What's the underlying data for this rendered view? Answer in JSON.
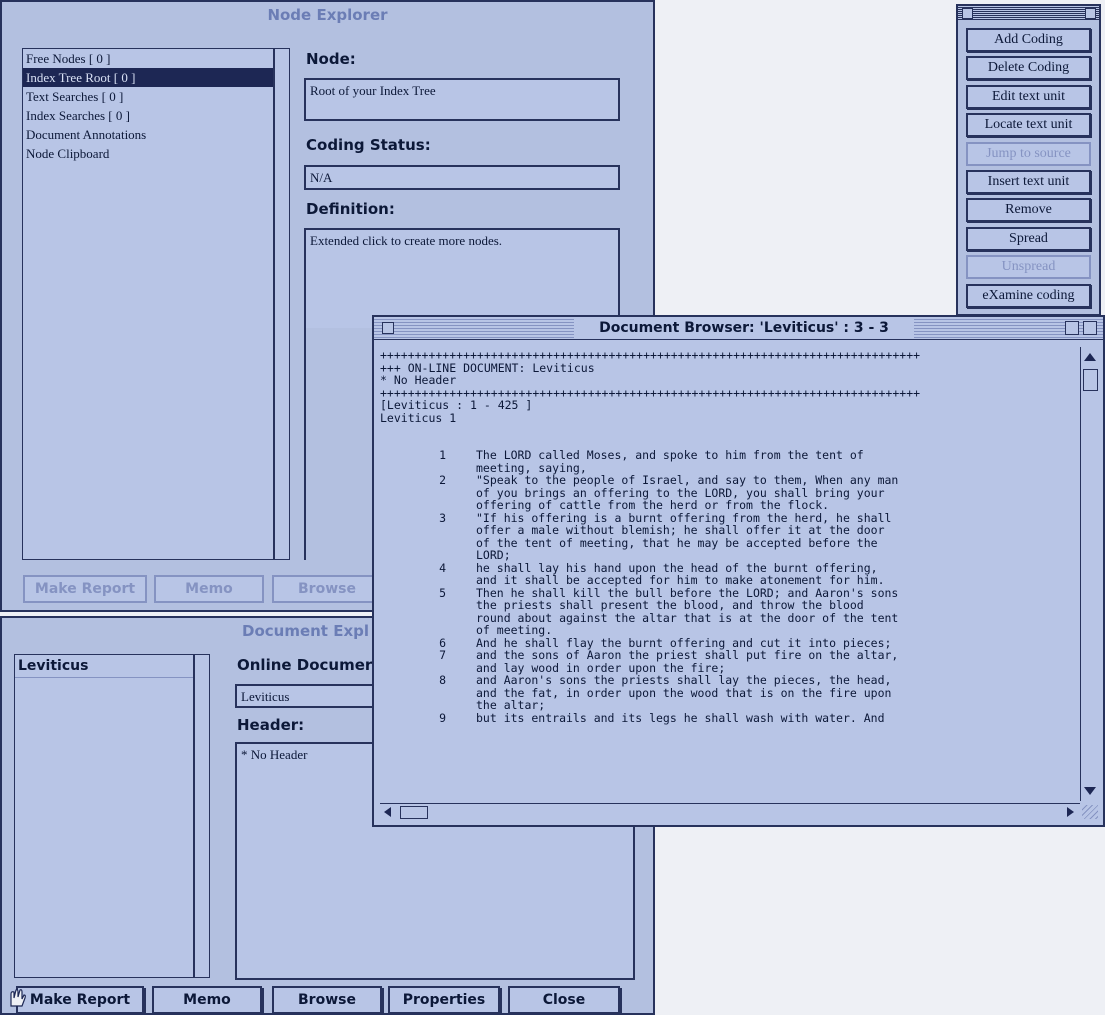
{
  "node_explorer": {
    "title": "Node Explorer",
    "tree_items": [
      "Free Nodes [ 0 ]",
      "Index Tree Root [ 0 ]",
      "Text Searches [ 0 ]",
      "Index Searches [ 0 ]",
      "Document Annotations",
      "Node Clipboard"
    ],
    "selected_index": 1,
    "node_label": "Node:",
    "node_value": "Root of your Index Tree",
    "coding_status_label": "Coding Status:",
    "coding_status_value": "N/A",
    "definition_label": "Definition:",
    "definition_value": "Extended click to create more nodes.",
    "buttons": {
      "make_report": "Make Report",
      "memo": "Memo",
      "browse": "Browse"
    }
  },
  "document_explorer": {
    "title": "Document Expl",
    "doc_items": [
      "Leviticus"
    ],
    "online_doc_label": "Online Documer",
    "online_doc_value": "Leviticus",
    "header_label": "Header:",
    "header_value": "* No Header",
    "buttons": {
      "make_report": "Make Report",
      "memo": "Memo",
      "browse": "Browse",
      "properties": "Properties",
      "close": "Close"
    }
  },
  "coding_palette": {
    "buttons": [
      {
        "label": "Add Coding",
        "enabled": true
      },
      {
        "label": "Delete Coding",
        "enabled": true
      },
      {
        "label": "Edit text unit",
        "enabled": true
      },
      {
        "label": "Locate text unit",
        "enabled": true
      },
      {
        "label": "Jump to source",
        "enabled": false
      },
      {
        "label": "Insert text unit",
        "enabled": true
      },
      {
        "label": "Remove",
        "enabled": true
      },
      {
        "label": "Spread",
        "enabled": true
      },
      {
        "label": "Unspread",
        "enabled": false
      },
      {
        "label": "eXamine coding",
        "enabled": true
      }
    ]
  },
  "document_browser": {
    "title": "Document Browser: 'Leviticus' : 3 - 3",
    "rule": "++++++++++++++++++++++++++++++++++++++++++++++++++++++++++++++++++++++++++++++",
    "head": [
      "+++ ON-LINE DOCUMENT: Leviticus",
      "* No Header"
    ],
    "range": "[Leviticus : 1 - 425 ]",
    "chapter": "Leviticus 1",
    "verses": [
      {
        "n": "1",
        "lines": [
          "The LORD called Moses, and spoke to him from the tent of",
          "meeting, saying,"
        ]
      },
      {
        "n": "2",
        "lines": [
          "\"Speak to the people of Israel, and say to them, When any man",
          "of you brings an offering to the LORD, you shall bring your",
          "offering of cattle from the herd or from the flock."
        ]
      },
      {
        "n": "3",
        "lines": [
          "\"If his offering is a burnt offering from the herd, he shall",
          "offer a male without blemish; he shall offer it at the door",
          "of the tent of meeting, that he may be accepted before the",
          "LORD;"
        ]
      },
      {
        "n": "4",
        "lines": [
          "he shall lay his hand upon the head of the burnt offering,",
          "and it shall be accepted for him to make atonement for him."
        ]
      },
      {
        "n": "5",
        "lines": [
          "Then he shall kill the bull before the LORD; and Aaron's sons",
          "the priests shall present the blood, and throw the blood",
          "round about against the altar that is at the door of the tent",
          "of meeting."
        ]
      },
      {
        "n": "6",
        "lines": [
          "And he shall flay the burnt offering and cut it into pieces;"
        ]
      },
      {
        "n": "7",
        "lines": [
          "and the sons of Aaron the priest shall put fire on the altar,",
          "and lay wood in order upon the fire;"
        ]
      },
      {
        "n": "8",
        "lines": [
          "and Aaron's sons the priests shall lay the pieces, the head,",
          "and the fat, in order upon the wood that is on the fire upon",
          "the altar;"
        ]
      },
      {
        "n": "9",
        "lines": [
          "but its entrails and its legs he shall wash with water. And"
        ]
      }
    ]
  }
}
